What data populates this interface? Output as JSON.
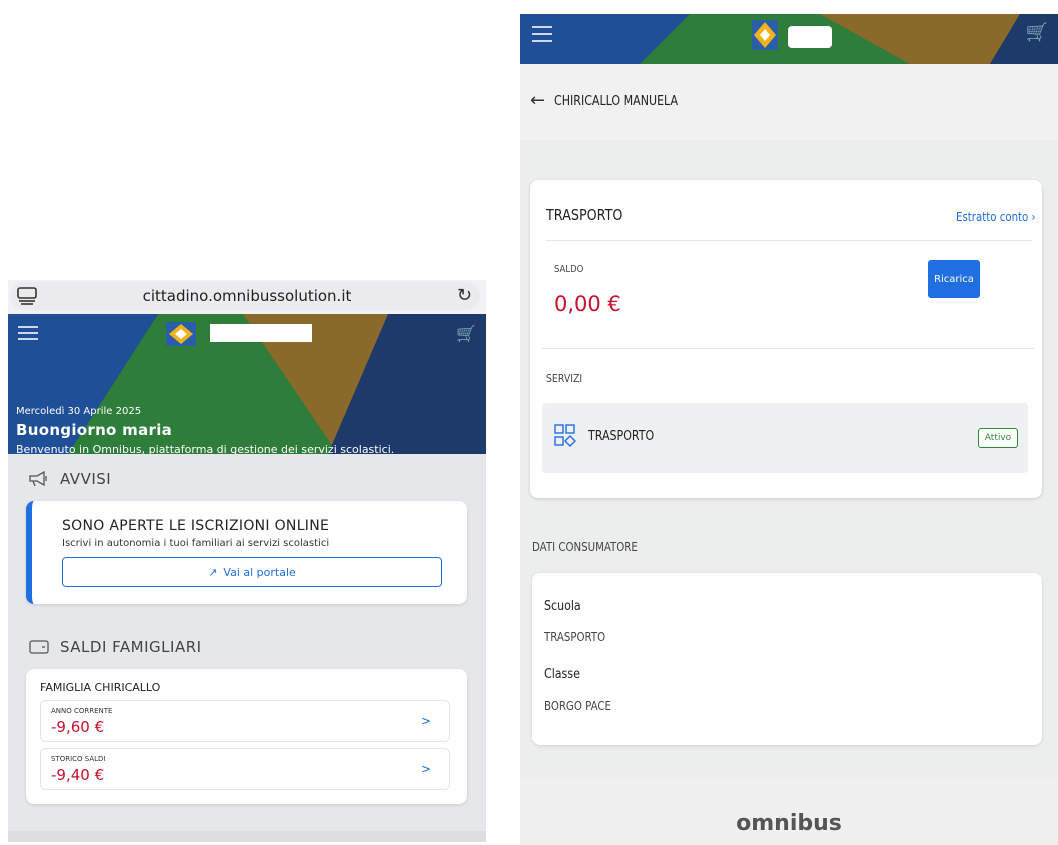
{
  "left": {
    "browser": {
      "url": "cittadino.omnibussolution.it",
      "tabs_icon": "tabs-icon",
      "reload_icon": "reload-icon"
    },
    "header": {
      "menu_icon": "hamburger-icon",
      "cart_icon": "cart-icon",
      "date": "Mercoledì 30 Aprile 2025",
      "greeting": "Buongiorno maria",
      "welcome": "Benvenuto in Omnibus, piattaforma di gestione dei servizi scolastici."
    },
    "avvisi": {
      "title": "AVVISI",
      "card_title": "SONO APERTE LE ISCRIZIONI ONLINE",
      "card_text": "Iscrivi in autonomia i tuoi familiari ai servizi scolastici",
      "button_label": "Vai al portale"
    },
    "saldi": {
      "title": "SALDI FAMIGLIARI",
      "family": "FAMIGLIA CHIRICALLO",
      "rows": [
        {
          "label": "ANNO CORRENTE",
          "value": "-9,60 €",
          "arrow": ">"
        },
        {
          "label": "STORICO SALDI",
          "value": "-9,40 €",
          "arrow": ">"
        }
      ]
    }
  },
  "right": {
    "header": {
      "menu_icon": "hamburger-icon",
      "cart_icon": "cart-icon"
    },
    "nav": {
      "back": "←",
      "name": "CHIRICALLO MANUELA"
    },
    "trasporto": {
      "title": "TRASPORTO",
      "estratto": "Estratto conto ›",
      "saldo_label": "SALDO",
      "saldo_value": "0,00 €",
      "ricarica": "Ricarica",
      "servizi_label": "SERVIZI",
      "service_name": "TRASPORTO",
      "service_status": "Attivo"
    },
    "dati": {
      "title": "DATI CONSUMATORE",
      "scuola_label": "Scuola",
      "scuola_value": "TRASPORTO",
      "classe_label": "Classe",
      "classe_value": "BORGO PACE"
    },
    "footer": {
      "brand": "omnibus"
    }
  },
  "colors": {
    "accent": "#1f6fe0",
    "negative": "#c8102e",
    "active_green": "#2d8a34",
    "navy": "#1d3a6a",
    "green": "#2f7d3a",
    "gold": "#8a6a2a"
  }
}
